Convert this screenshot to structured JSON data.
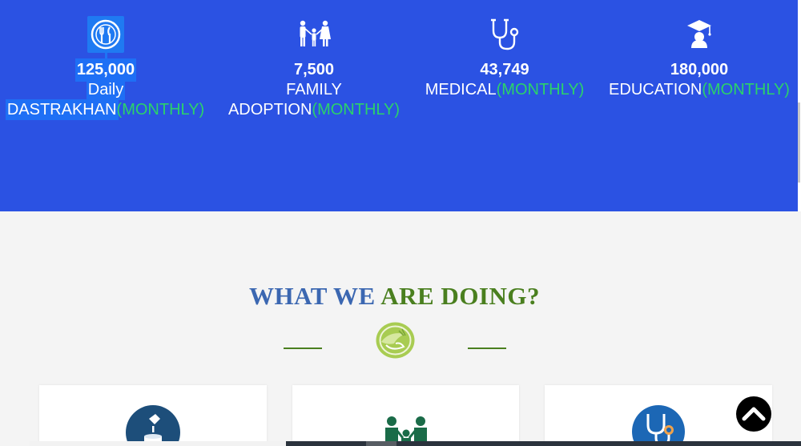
{
  "stats": [
    {
      "icon": "dining-plate-icon",
      "value": "125,000",
      "label_lines": [
        "Daily",
        "DASTRAKHAN"
      ],
      "suffix": "(MONTHLY)"
    },
    {
      "icon": "family-icon",
      "value": "7,500",
      "label_lines": [
        "FAMILY",
        "ADOPTION"
      ],
      "suffix": "(MONTHLY)"
    },
    {
      "icon": "stethoscope-icon",
      "value": "43,749",
      "label_lines": [
        "MEDICAL"
      ],
      "suffix": "(MONTHLY)"
    },
    {
      "icon": "graduation-cap-icon",
      "value": "180,000",
      "label_lines": [
        "EDUCATION"
      ],
      "suffix": "(MONTHLY)"
    }
  ],
  "section": {
    "title_part_a": "WHAT WE",
    "title_part_b": "ARE DOING?"
  },
  "cards": [
    {
      "icon": "donation-jar-icon"
    },
    {
      "icon": "family-icon"
    },
    {
      "icon": "medical-stethoscope-icon"
    }
  ],
  "colors": {
    "band_blue": "#2b52e3",
    "accent_green": "#2bd26a",
    "title_blue": "#3b67b1",
    "title_green": "#4a7f1f"
  }
}
